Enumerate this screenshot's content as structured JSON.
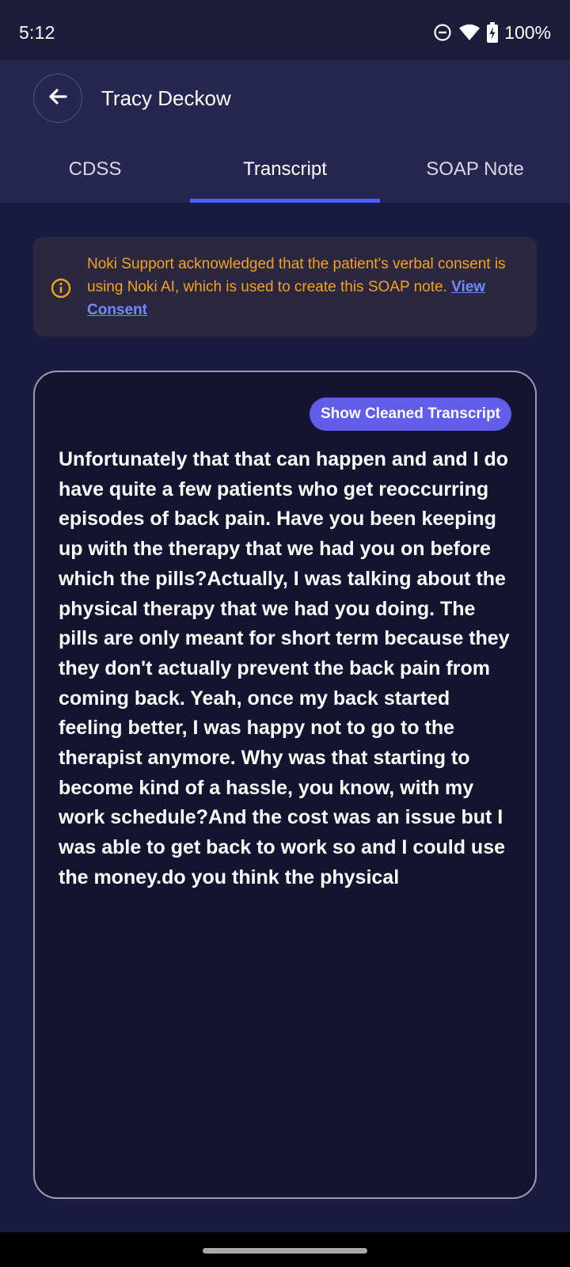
{
  "status_bar": {
    "time": "5:12",
    "battery": "100%",
    "icons": [
      "do-not-disturb-icon",
      "wifi-icon",
      "battery-charging-icon"
    ]
  },
  "header": {
    "title": "Tracy Deckow",
    "back_icon": "arrow-left-icon"
  },
  "tabs": [
    {
      "label": "CDSS",
      "active": false
    },
    {
      "label": "Transcript",
      "active": true
    },
    {
      "label": "SOAP Note",
      "active": false
    }
  ],
  "notice": {
    "icon": "info-icon",
    "text": "Noki Support acknowledged that the patient's verbal consent is using Noki AI, which is used to create this SOAP note. ",
    "link": "View Consent"
  },
  "transcript": {
    "button": "Show Cleaned Transcript",
    "body": "Unfortunately that that can happen and and I do have quite a few patients who get reoccurring episodes of back pain. Have you been keeping up with the therapy that we had you on before which the pills?Actually, I was talking about the physical therapy that we had you doing. The pills are only meant for short term because they they don't actually prevent the back pain from coming back. Yeah, once my back started feeling better, I was happy not to go to the therapist anymore. Why was that starting to become kind of a hassle, you know, with my work schedule?And the cost was an issue but I was able to get back to work so and I could use the money.do you think the physical"
  },
  "colors": {
    "background": "#1b1b3f",
    "header": "#27264f",
    "accent": "#4d61ff",
    "warning": "#f1a31d",
    "button": "#5f5de9"
  }
}
